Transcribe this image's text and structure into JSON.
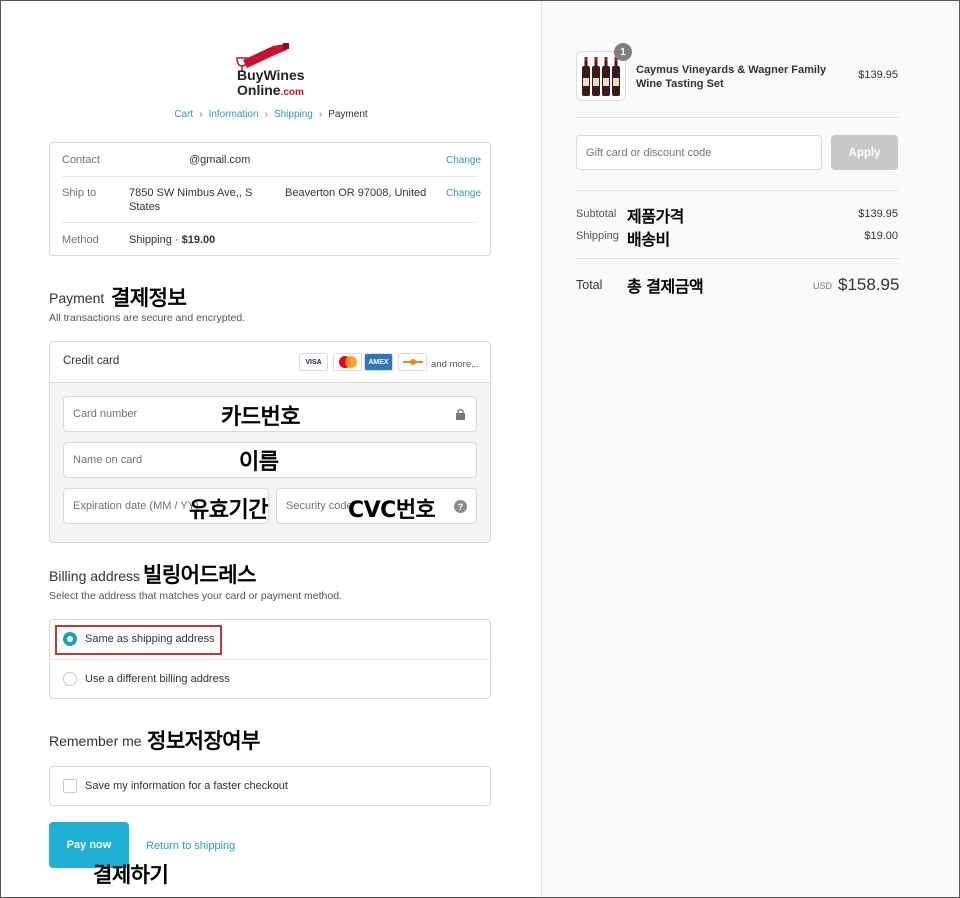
{
  "logo": {
    "line1": "BuyWines",
    "line2": "Online",
    "suffix": ".com"
  },
  "breadcrumb": {
    "cart": "Cart",
    "information": "Information",
    "shipping": "Shipping",
    "payment": "Payment"
  },
  "info": {
    "contact_label": "Contact",
    "contact_value": "@gmail.com",
    "ship_label": "Ship to",
    "ship_line1": "7850 SW Nimbus Ave,, S",
    "ship_line1b": "Beaverton OR 97008, United",
    "ship_line2": "States",
    "method_label": "Method",
    "method_value": "Shipping · ",
    "method_price": "$19.00",
    "change": "Change"
  },
  "payment": {
    "title": "Payment",
    "title_kr": "결제정보",
    "subtitle": "All transactions are secure and encrypted.",
    "method": "Credit card",
    "cards": [
      "VISA",
      "MC",
      "AMEX",
      "DISC"
    ],
    "and_more": "and more...",
    "card_number": "Card number",
    "card_number_kr": "카드번호",
    "name_on_card": "Name on card",
    "name_kr": "이름",
    "expiration": "Expiration date (MM / YY)",
    "expiration_kr": "유효기간",
    "security": "Security code",
    "security_kr": "CVC번호"
  },
  "billing": {
    "title": "Billing address",
    "title_kr": "빌링어드레스",
    "subtitle": "Select the address that matches your card or payment method.",
    "option_same": "Same as shipping address",
    "option_diff": "Use a different billing address"
  },
  "remember": {
    "title": "Remember me",
    "title_kr": "정보저장여부",
    "option": "Save my information for a faster checkout"
  },
  "actions": {
    "pay_now": "Pay now",
    "pay_kr": "결제하기",
    "return": "Return to shipping"
  },
  "summary": {
    "qty": "1",
    "product": "Caymus Vineyards & Wagner Family Wine Tasting Set",
    "product_price": "$139.95",
    "gift_placeholder": "Gift card or discount code",
    "apply": "Apply",
    "subtotal_label": "Subtotal",
    "subtotal_kr": "제품가격",
    "subtotal_value": "$139.95",
    "shipping_label": "Shipping",
    "shipping_kr": "배송비",
    "shipping_value": "$19.00",
    "total_label": "Total",
    "total_kr": "총 결제금액",
    "currency": "USD",
    "total_value": "$158.95"
  },
  "colors": {
    "accent": "#1fb0d6",
    "link": "#2b9cb8",
    "brand": "#c8102e",
    "highlight": "#c0392b"
  }
}
